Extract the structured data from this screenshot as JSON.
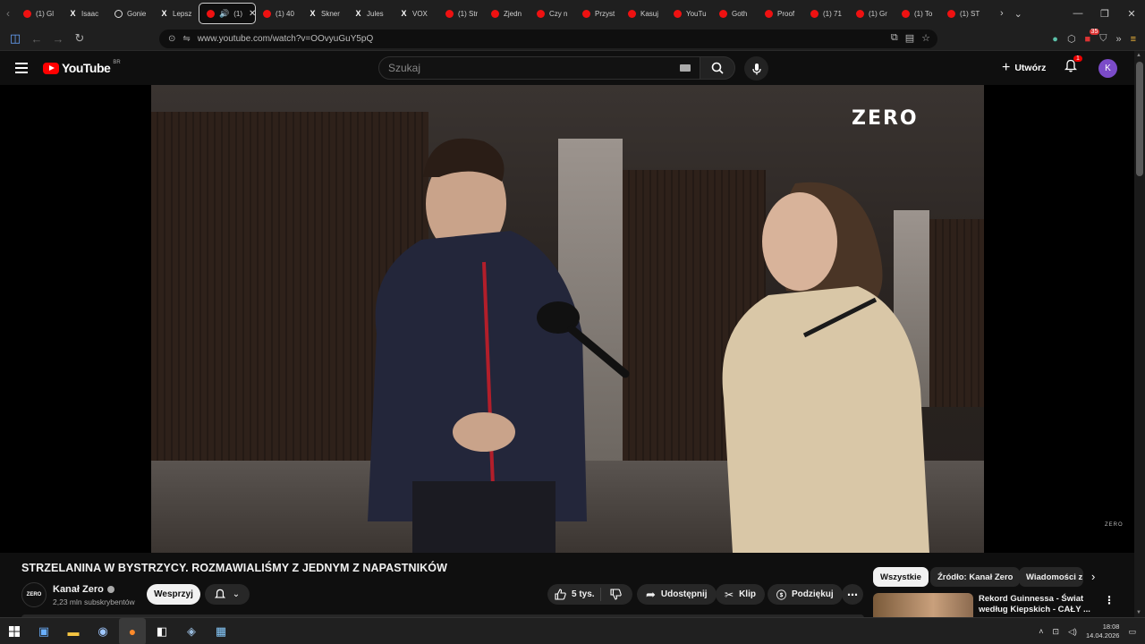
{
  "browser": {
    "tabs": [
      {
        "icon": "youtube-icon",
        "label": "(1) Gl"
      },
      {
        "icon": "x-icon",
        "label": "Isaac"
      },
      {
        "icon": "circle-icon",
        "label": "Gonie"
      },
      {
        "icon": "x-icon",
        "label": "Lepsz"
      },
      {
        "icon": "youtube-icon",
        "label": "(1)",
        "active": true,
        "audio": true
      },
      {
        "icon": "youtube-icon",
        "label": "(1) 40"
      },
      {
        "icon": "x-icon",
        "label": "Skner"
      },
      {
        "icon": "x-icon",
        "label": "Jules"
      },
      {
        "icon": "x-icon",
        "label": "VOX"
      },
      {
        "icon": "youtube-icon",
        "label": "(1) Str"
      },
      {
        "icon": "youtube-icon",
        "label": "Zjedn"
      },
      {
        "icon": "youtube-icon",
        "label": "Czy n"
      },
      {
        "icon": "youtube-icon",
        "label": "Przyst"
      },
      {
        "icon": "youtube-icon",
        "label": "Kasuj"
      },
      {
        "icon": "youtube-icon",
        "label": "YouTu"
      },
      {
        "icon": "youtube-icon",
        "label": "Goth"
      },
      {
        "icon": "youtube-icon",
        "label": "Proof"
      },
      {
        "icon": "youtube-icon",
        "label": "(1) 71"
      },
      {
        "icon": "youtube-icon",
        "label": "(1) Gr"
      },
      {
        "icon": "youtube-icon",
        "label": "(1) To"
      },
      {
        "icon": "youtube-icon",
        "label": "(1) ST"
      }
    ],
    "url": "www.youtube.com/watch?v=OOvyuGuY5pQ",
    "extension_badge": "35"
  },
  "youtube": {
    "logo_text": "YouTube",
    "country_code": "BR",
    "search_placeholder": "Szukaj",
    "create_label": "Utwórz",
    "notification_count": "1",
    "avatar_letter": "K"
  },
  "video": {
    "watermark": "ZERO",
    "watermark_small": "ZERO",
    "title": "STRZELANINA W BYSTRZYCY. ROZMAWIALIŚMY Z JEDNYM Z NAPASTNIKÓW",
    "channel_name": "Kanał Zero",
    "channel_avatar_text": "ZERO",
    "subscribers": "2,23 mln subskrybentów",
    "support_label": "Wesprzyj",
    "likes": "5 tys.",
    "share_label": "Udostępnij",
    "clip_label": "Klip",
    "thanks_label": "Podziękuj"
  },
  "sidebar": {
    "chips": [
      "Wszystkie",
      "Źródło: Kanał Zero",
      "Wiadomości z"
    ],
    "recommendation_title": "Rekord Guinnessa - Świat według Kiepskich - CAŁY ..."
  },
  "taskbar": {
    "time": "18:08",
    "date": "14.04.2026"
  },
  "colors": {
    "youtube_red": "#ff0000",
    "avatar": "#7b4bc8",
    "background": "#0f0f0f"
  }
}
